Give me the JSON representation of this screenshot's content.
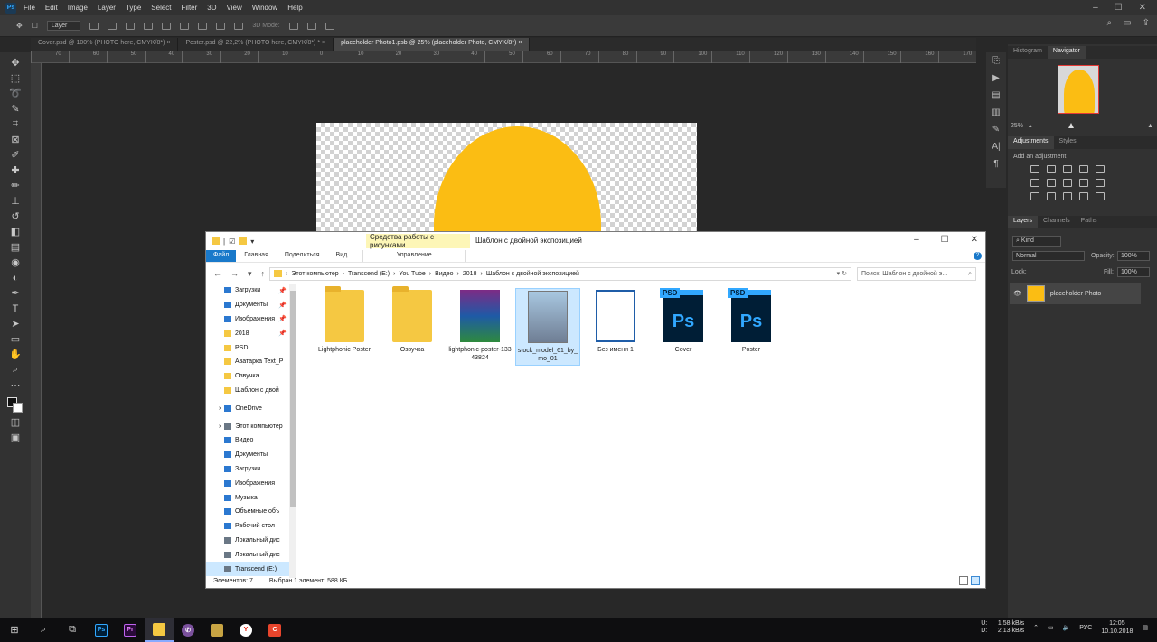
{
  "photoshop": {
    "logo": "Ps",
    "menu": [
      "File",
      "Edit",
      "Image",
      "Layer",
      "Type",
      "Select",
      "Filter",
      "3D",
      "View",
      "Window",
      "Help"
    ],
    "options": {
      "auto_select": "Layer",
      "mode_3d": "3D Mode:"
    },
    "tabs": [
      {
        "label": "Cover.psd @ 100% (PHOTO here, CMYK/8*)",
        "active": false
      },
      {
        "label": "Poster.psd @ 22,2% (PHOTO here, CMYK/8*) *",
        "active": false
      },
      {
        "label": "placeholder Photo1.psb @ 25% (placeholder Photo, CMYK/8*)",
        "active": true
      }
    ],
    "ruler_ticks": [
      "70",
      "60",
      "50",
      "40",
      "30",
      "20",
      "10",
      "0",
      "10",
      "20",
      "30",
      "40",
      "50",
      "60",
      "70",
      "80",
      "90",
      "100",
      "110",
      "120",
      "130",
      "140",
      "150",
      "160",
      "170"
    ],
    "navigator": {
      "tabs": [
        "Histogram",
        "Navigator"
      ],
      "zoom": "25%"
    },
    "adjustments": {
      "tabs": [
        "Adjustments",
        "Styles"
      ],
      "label": "Add an adjustment"
    },
    "layers": {
      "tabs": [
        "Layers",
        "Channels",
        "Paths"
      ],
      "filter": "Kind",
      "blend_mode": "Normal",
      "opacity_label": "Opacity:",
      "opacity": "100%",
      "lock_label": "Lock:",
      "fill_label": "Fill:",
      "fill": "100%",
      "layer_name": "placeholder Photo"
    },
    "accent_color": "#31a8ff",
    "shape_color": "#fbbd13"
  },
  "explorer": {
    "context_tab": "Средства работы с рисунками",
    "window_title": "Шаблон с двойной экспозицией",
    "ribbon": {
      "file": "Файл",
      "home": "Главная",
      "share": "Поделиться",
      "view": "Вид",
      "manage": "Управление"
    },
    "breadcrumb": [
      "Этот компьютер",
      "Transcend (E:)",
      "You Tube",
      "Видео",
      "2018",
      "Шаблон с двойной экспозицией"
    ],
    "search_placeholder": "Поиск: Шаблон с двойной э...",
    "nav": [
      {
        "label": "Загрузки",
        "icon": "download-icon",
        "pin": true
      },
      {
        "label": "Документы",
        "icon": "documents-icon",
        "pin": true
      },
      {
        "label": "Изображения",
        "icon": "pictures-icon",
        "pin": true
      },
      {
        "label": "2018",
        "icon": "folder-icon",
        "pin": true
      },
      {
        "label": "PSD",
        "icon": "folder-icon",
        "pin": false
      },
      {
        "label": "Аватарка Text_P",
        "icon": "folder-icon",
        "pin": false
      },
      {
        "label": "Озвучка",
        "icon": "folder-icon",
        "pin": false
      },
      {
        "label": "Шаблон с двой",
        "icon": "folder-icon",
        "pin": false
      },
      {
        "label": "OneDrive",
        "icon": "onedrive-icon",
        "pin": false
      },
      {
        "label": "Этот компьютер",
        "icon": "computer-icon",
        "pin": false
      },
      {
        "label": "Видео",
        "icon": "video-icon",
        "pin": false
      },
      {
        "label": "Документы",
        "icon": "documents-icon",
        "pin": false
      },
      {
        "label": "Загрузки",
        "icon": "download-icon",
        "pin": false
      },
      {
        "label": "Изображения",
        "icon": "pictures-icon",
        "pin": false
      },
      {
        "label": "Музыка",
        "icon": "music-icon",
        "pin": false
      },
      {
        "label": "Объемные объ",
        "icon": "3d-objects-icon",
        "pin": false
      },
      {
        "label": "Рабочий стол",
        "icon": "desktop-icon",
        "pin": false
      },
      {
        "label": "Локальный дис",
        "icon": "drive-icon",
        "pin": false
      },
      {
        "label": "Локальный дис",
        "icon": "drive-icon",
        "pin": false
      },
      {
        "label": "Transcend (E:)",
        "icon": "drive-icon",
        "pin": false
      }
    ],
    "files": [
      {
        "name": "Lightphonic Poster",
        "type": "folder",
        "selected": false
      },
      {
        "name": "Озвучка",
        "type": "folder",
        "selected": false
      },
      {
        "name": "lightphonic-poster-13343824",
        "type": "rar",
        "selected": false
      },
      {
        "name": "stock_model_61_by_mo_01",
        "type": "photo",
        "selected": true
      },
      {
        "name": "Без имени 1",
        "type": "doc",
        "selected": false
      },
      {
        "name": "Cover",
        "type": "psd",
        "selected": false
      },
      {
        "name": "Poster",
        "type": "psd",
        "selected": false
      }
    ],
    "psd_tag": "PSD",
    "psd_glyph": "Ps",
    "status_count": "Элементов: 7",
    "status_selected": "Выбран 1 элемент: 588 КБ"
  },
  "taskbar": {
    "net_up_label": "U:",
    "net_up": "1,58 kB/s",
    "net_down_label": "D:",
    "net_down": "2,13 kB/s",
    "lang": "РУС",
    "time": "12:05",
    "date": "10.10.2018"
  }
}
